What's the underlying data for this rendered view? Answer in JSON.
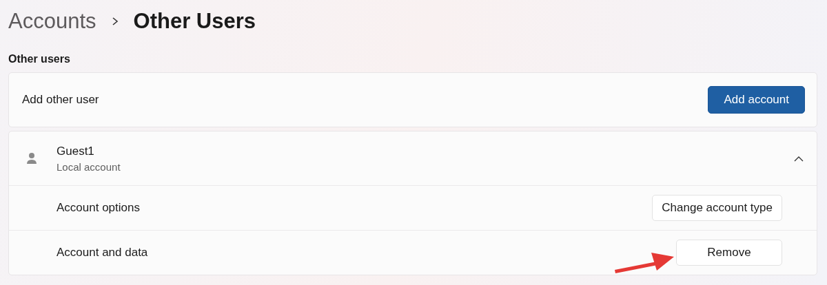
{
  "breadcrumb": [
    {
      "label": "Accounts",
      "current": false
    },
    {
      "label": "Other Users",
      "current": true
    }
  ],
  "section_title": "Other users",
  "add_row": {
    "label": "Add other user",
    "button": {
      "label": "Add account",
      "kind": "primary"
    }
  },
  "users": [
    {
      "name": "Guest1",
      "subtitle": "Local account",
      "expanded": true,
      "options": [
        {
          "label": "Account options",
          "button": {
            "label": "Change account type"
          }
        },
        {
          "label": "Account and data",
          "button": {
            "label": "Remove"
          }
        }
      ]
    }
  ]
}
